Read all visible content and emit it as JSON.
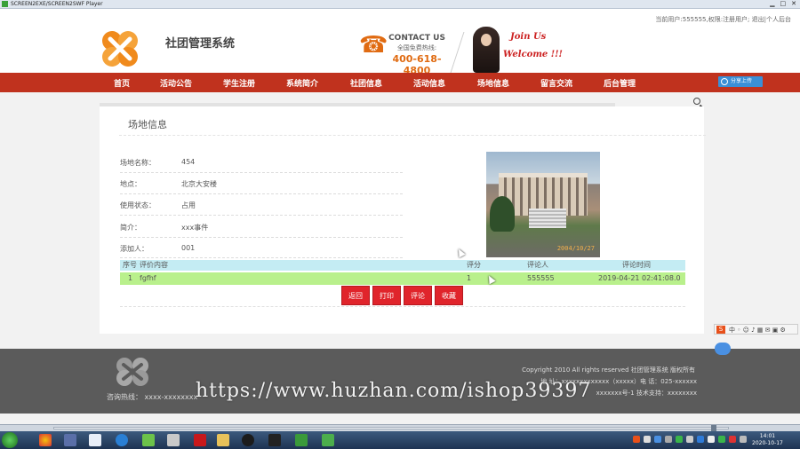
{
  "window": {
    "title": "SCREEN2EXE/SCREEN2SWF Player"
  },
  "header": {
    "user_info": "当前用户:555555,权限:注册用户; 退出|个人后台",
    "site_name": "社团管理系统",
    "contact_title": "CONTACT US",
    "contact_sub": "全国免费热线:",
    "contact_phone": "400-618-4800",
    "join_text": "Join Us",
    "welcome_text": "Welcome !!!"
  },
  "nav": {
    "items": [
      "首页",
      "活动公告",
      "学生注册",
      "系统简介",
      "社团信息",
      "活动信息",
      "场地信息",
      "留言交流",
      "后台管理"
    ],
    "share_label": "分享上传"
  },
  "page": {
    "title": "场地信息",
    "fields": [
      {
        "label": "场地名称：",
        "value": "454"
      },
      {
        "label": "地点：",
        "value": "北京大安楼"
      },
      {
        "label": "使用状态：",
        "value": "占用"
      },
      {
        "label": "简介：",
        "value": "xxx事件"
      },
      {
        "label": "添加人：",
        "value": "001"
      }
    ],
    "photo_stamp": "2004/10/27"
  },
  "reviews": {
    "headers": {
      "no": "序号",
      "content": "评价内容",
      "score": "评分",
      "reviewer": "评论人",
      "time": "评论时间"
    },
    "rows": [
      {
        "no": "1",
        "content": "fgfhf",
        "score": "1",
        "reviewer": "555555",
        "time": "2019-04-21 02:41:08.0"
      }
    ]
  },
  "buttons": {
    "back": "返回",
    "print": "打印",
    "review": "评论",
    "favorite": "收藏"
  },
  "footer": {
    "hotline": "咨询热线： xxxx-xxxxxxxx",
    "copyright": "Copyright 2010 All rights reserved 社团管理系统 版权所有",
    "address": "地 址：xxxxxxxxxxxxx（xxxxx）电 话：025-xxxxxx",
    "icp": "xxxxxxx号-1 技术支持：xxxxxxxx"
  },
  "watermark": "https://www.huzhan.com/ishop39397",
  "clock": {
    "time": "14:01",
    "date": "2020-10-17"
  },
  "colors": {
    "nav": "#c0321e",
    "button": "#e0242b",
    "accent": "#e06b12",
    "review_head": "#c4ecf3",
    "review_row": "#b9f08c",
    "footer": "#5b5b5b"
  }
}
